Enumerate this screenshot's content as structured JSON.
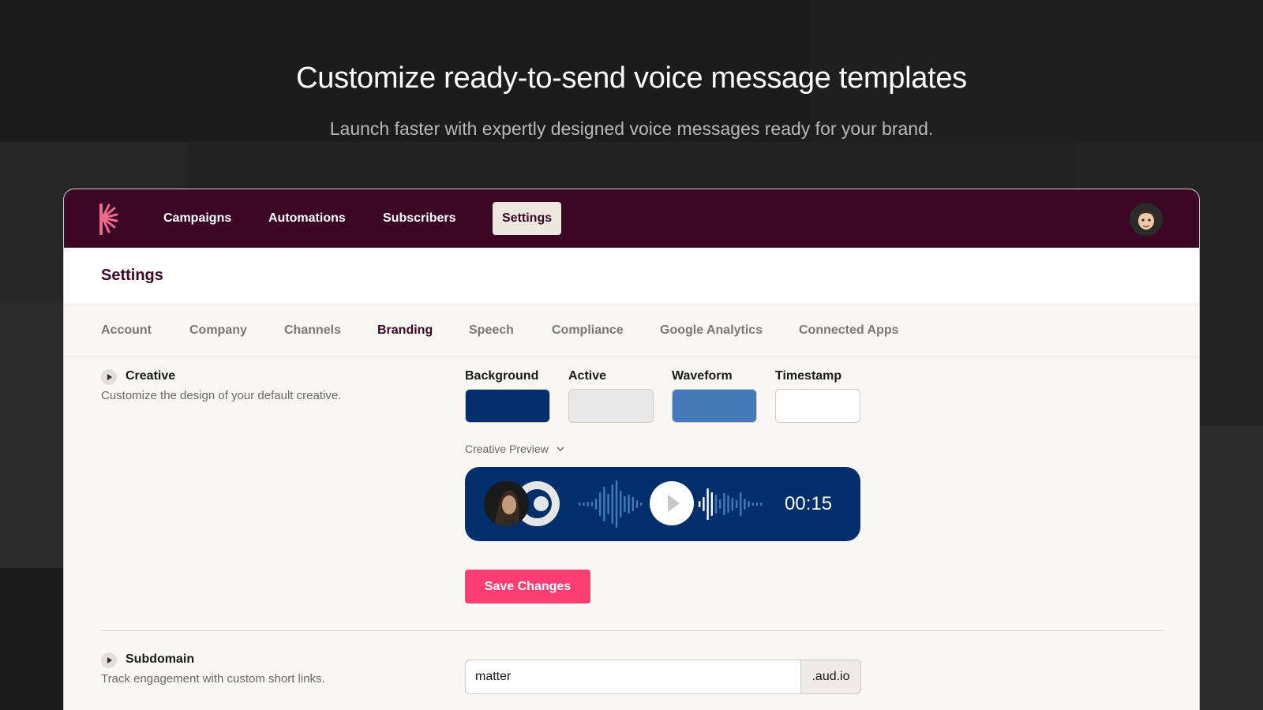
{
  "hero": {
    "title": "Customize ready-to-send voice message templates",
    "subtitle": "Launch faster with expertly designed voice messages ready for your brand."
  },
  "nav": {
    "items": [
      {
        "label": "Campaigns",
        "active": false
      },
      {
        "label": "Automations",
        "active": false
      },
      {
        "label": "Subscribers",
        "active": false
      },
      {
        "label": "Settings",
        "active": true
      }
    ],
    "logo_icon": "sunburst-logo-icon",
    "avatar_icon": "user-avatar-icon"
  },
  "page": {
    "title": "Settings"
  },
  "tabs": [
    {
      "label": "Account",
      "active": false
    },
    {
      "label": "Company",
      "active": false
    },
    {
      "label": "Channels",
      "active": false
    },
    {
      "label": "Branding",
      "active": true
    },
    {
      "label": "Speech",
      "active": false
    },
    {
      "label": "Compliance",
      "active": false
    },
    {
      "label": "Google Analytics",
      "active": false
    },
    {
      "label": "Connected Apps",
      "active": false
    }
  ],
  "creative": {
    "title": "Creative",
    "description": "Customize the design of your default creative.",
    "swatches": [
      {
        "label": "Background",
        "color": "#002f6c"
      },
      {
        "label": "Active",
        "color": "#e8e8e8"
      },
      {
        "label": "Waveform",
        "color": "#4479ba"
      },
      {
        "label": "Timestamp",
        "color": "#ffffff"
      }
    ],
    "preview_label": "Creative Preview",
    "timestamp": "00:15",
    "save_label": "Save Changes"
  },
  "subdomain": {
    "title": "Subdomain",
    "description": "Track engagement with custom short links.",
    "value": "matter",
    "suffix": ".aud.io"
  },
  "colors": {
    "brand_dark": "#3c0625",
    "accent": "#ff3e73",
    "preview_bg": "#002f6c",
    "waveform": "#4479ba"
  }
}
